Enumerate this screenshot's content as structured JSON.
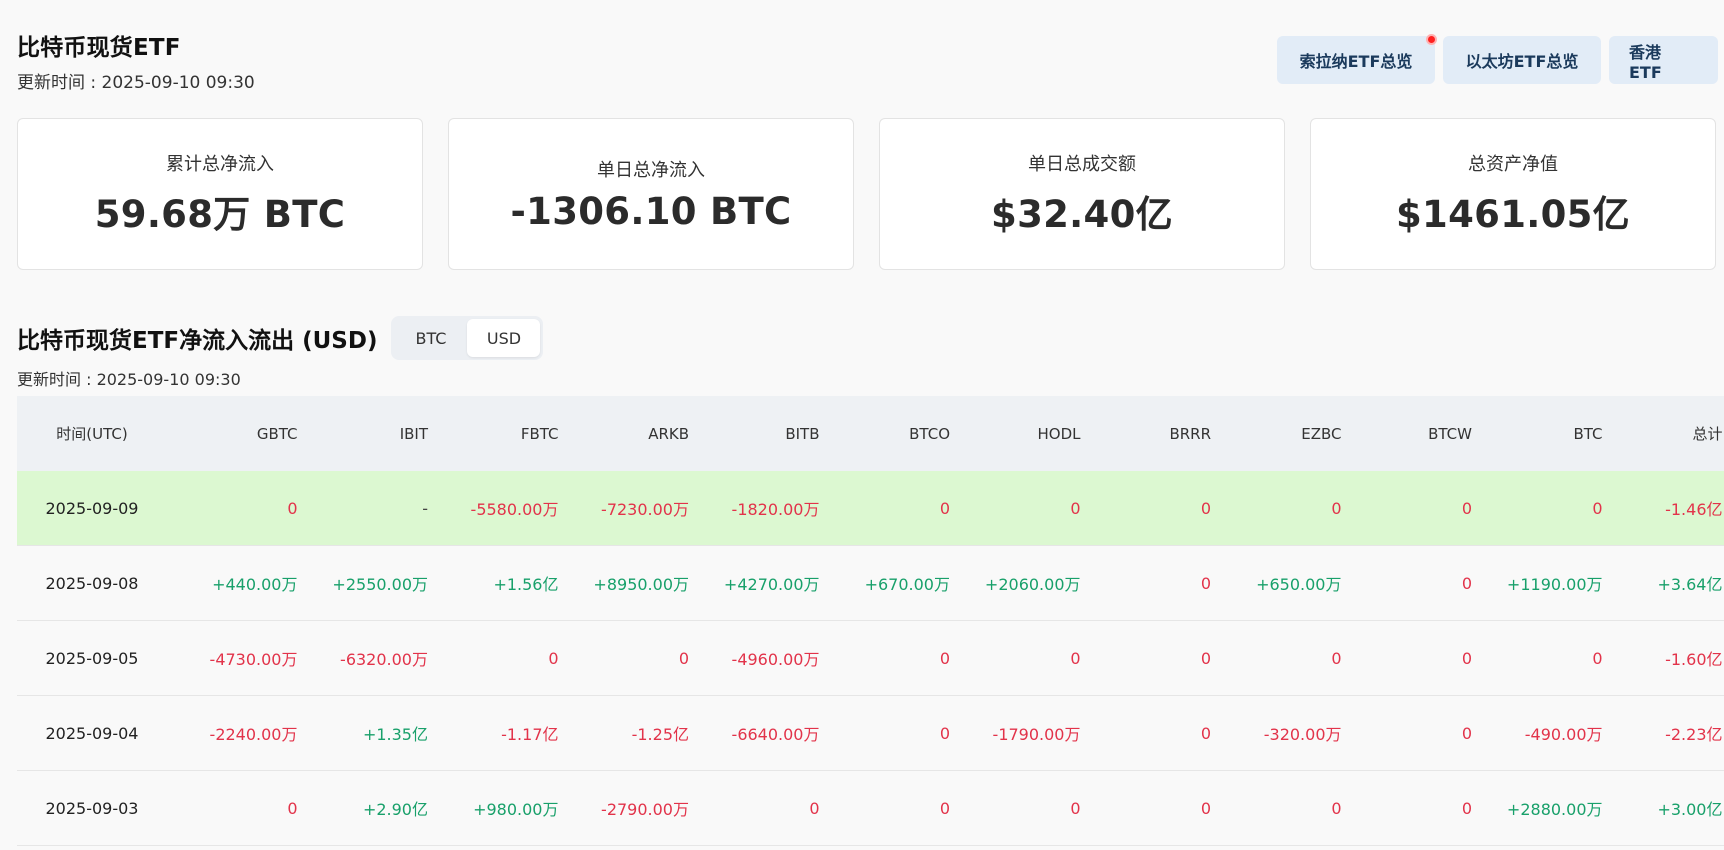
{
  "header": {
    "title": "比特币现货ETF",
    "update_time": "更新时间 : 2025-09-10 09:30"
  },
  "nav": {
    "sol_label": "索拉纳ETF总览",
    "eth_label": "以太坊ETF总览",
    "hk_label": "香港 ETF"
  },
  "cards": [
    {
      "label": "累计总净流入",
      "value": "59.68万 BTC"
    },
    {
      "label": "单日总净流入",
      "value": "-1306.10 BTC"
    },
    {
      "label": "单日总成交额",
      "value": "$32.40亿"
    },
    {
      "label": "总资产净值",
      "value": "$1461.05亿"
    }
  ],
  "section": {
    "title": "比特币现货ETF净流入流出 (USD)",
    "toggle_btc": "BTC",
    "toggle_usd": "USD",
    "active_toggle": "USD",
    "update_time": "更新时间 : 2025-09-10 09:30"
  },
  "table": {
    "columns": [
      "时间(UTC)",
      "GBTC",
      "IBIT",
      "FBTC",
      "ARKB",
      "BITB",
      "BTCO",
      "HODL",
      "BRRR",
      "EZBC",
      "BTCW",
      "BTC",
      "总计"
    ],
    "rows": [
      {
        "highlight": true,
        "cells": [
          "2025-09-09",
          "0",
          "-",
          "-5580.00万",
          "-7230.00万",
          "-1820.00万",
          "0",
          "0",
          "0",
          "0",
          "0",
          "0",
          "-1.46亿"
        ]
      },
      {
        "highlight": false,
        "cells": [
          "2025-09-08",
          "+440.00万",
          "+2550.00万",
          "+1.56亿",
          "+8950.00万",
          "+4270.00万",
          "+670.00万",
          "+2060.00万",
          "0",
          "+650.00万",
          "0",
          "+1190.00万",
          "+3.64亿"
        ]
      },
      {
        "highlight": false,
        "cells": [
          "2025-09-05",
          "-4730.00万",
          "-6320.00万",
          "0",
          "0",
          "-4960.00万",
          "0",
          "0",
          "0",
          "0",
          "0",
          "0",
          "-1.60亿"
        ]
      },
      {
        "highlight": false,
        "cells": [
          "2025-09-04",
          "-2240.00万",
          "+1.35亿",
          "-1.17亿",
          "-1.25亿",
          "-6640.00万",
          "0",
          "-1790.00万",
          "0",
          "-320.00万",
          "0",
          "-490.00万",
          "-2.23亿"
        ]
      },
      {
        "highlight": false,
        "cells": [
          "2025-09-03",
          "0",
          "+2.90亿",
          "+980.00万",
          "-2790.00万",
          "0",
          "0",
          "0",
          "0",
          "0",
          "0",
          "+2880.00万",
          "+3.00亿"
        ]
      }
    ]
  },
  "colors": {
    "positive": "#18a06a",
    "negative": "#e2334a",
    "highlight_row": "#dcf8d1",
    "nav_button_bg": "#e2ecf7",
    "notification_dot": "#ff2020"
  }
}
